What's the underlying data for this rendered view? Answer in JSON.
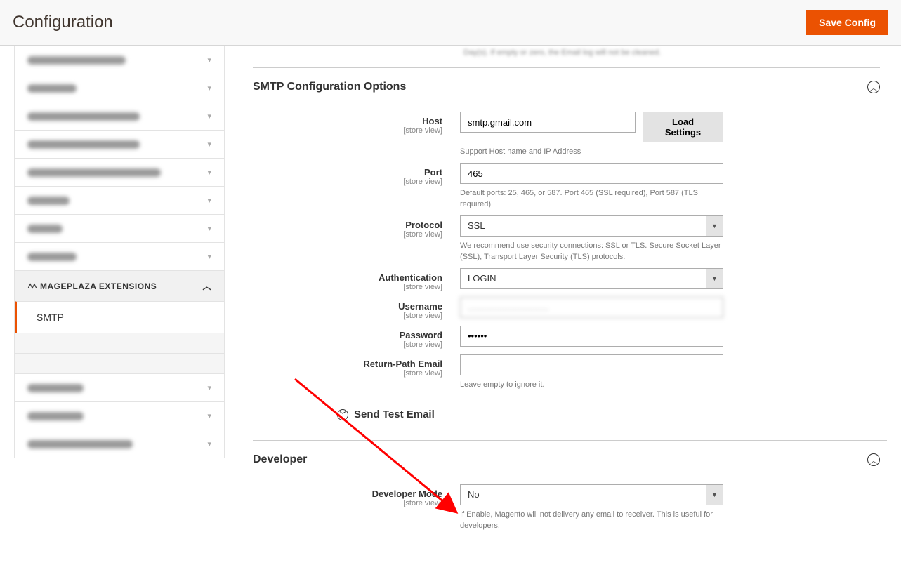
{
  "header": {
    "title": "Configuration",
    "save_button": "Save Config"
  },
  "sidebar": {
    "section_label": "MAGEPLAZA EXTENSIONS",
    "active_sub": "SMTP"
  },
  "truncated_hint": "Day(s). If empty or zero, the Email log will not be cleaned.",
  "sections": {
    "smtp": {
      "title": "SMTP Configuration Options",
      "host": {
        "label": "Host",
        "scope": "[store view]",
        "value": "smtp.gmail.com",
        "hint": "Support Host name and IP Address",
        "button": "Load Settings"
      },
      "port": {
        "label": "Port",
        "scope": "[store view]",
        "value": "465",
        "hint": "Default ports: 25, 465, or 587. Port 465 (SSL required), Port 587 (TLS required)"
      },
      "protocol": {
        "label": "Protocol",
        "scope": "[store view]",
        "value": "SSL",
        "hint": "We recommend use security connections: SSL or TLS. Secure Socket Layer (SSL), Transport Layer Security (TLS) protocols."
      },
      "auth": {
        "label": "Authentication",
        "scope": "[store view]",
        "value": "LOGIN"
      },
      "username": {
        "label": "Username",
        "scope": "[store view]",
        "value": "................................"
      },
      "password": {
        "label": "Password",
        "scope": "[store view]",
        "value": "••••••"
      },
      "returnpath": {
        "label": "Return-Path Email",
        "scope": "[store view]",
        "value": "",
        "hint": "Leave empty to ignore it."
      },
      "send_test": "Send Test Email"
    },
    "dev": {
      "title": "Developer",
      "mode": {
        "label": "Developer Mode",
        "scope": "[store view]",
        "value": "No",
        "hint": "If Enable, Magento will not delivery any email to receiver. This is useful for developers."
      }
    }
  }
}
